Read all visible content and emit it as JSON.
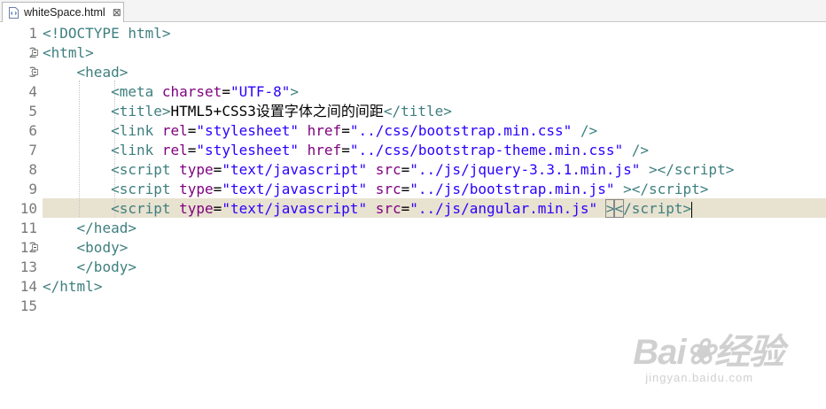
{
  "tab": {
    "filename": "whiteSpace.html",
    "close_symbol": "⊠"
  },
  "lines": [
    {
      "num": "1"
    },
    {
      "num": "2"
    },
    {
      "num": "3"
    },
    {
      "num": "4"
    },
    {
      "num": "5"
    },
    {
      "num": "6"
    },
    {
      "num": "7"
    },
    {
      "num": "8"
    },
    {
      "num": "9"
    },
    {
      "num": "10"
    },
    {
      "num": "11"
    },
    {
      "num": "12"
    },
    {
      "num": "13"
    },
    {
      "num": "14"
    },
    {
      "num": "15"
    }
  ],
  "code": {
    "doctype": "<!DOCTYPE html>",
    "html_open": "html",
    "head_open": "head",
    "meta": {
      "tag": "meta",
      "attr": "charset",
      "value": "\"UTF-8\""
    },
    "title": {
      "tag": "title",
      "text": "HTML5+CSS3设置字体之间的间距",
      "close": "/title"
    },
    "link1": {
      "tag": "link",
      "rel_attr": "rel",
      "rel": "\"stylesheet\"",
      "href_attr": "href",
      "href": "\"../css/bootstrap.min.css\""
    },
    "link2": {
      "tag": "link",
      "rel_attr": "rel",
      "rel": "\"stylesheet\"",
      "href_attr": "href",
      "href": "\"../css/bootstrap-theme.min.css\""
    },
    "script1": {
      "tag": "script",
      "type_attr": "type",
      "type": "\"text/javascript\"",
      "src_attr": "src",
      "src": "\"../js/jquery-3.3.1.min.js\"",
      "close": "/script"
    },
    "script2": {
      "tag": "script",
      "type_attr": "type",
      "type": "\"text/javascript\"",
      "src_attr": "src",
      "src": "\"../js/bootstrap.min.js\"",
      "close": "/script"
    },
    "script3": {
      "tag": "script",
      "type_attr": "type",
      "type": "\"text/javascript\"",
      "src_attr": "src",
      "src": "\"../js/angular.min.js\"",
      "close": "/script"
    },
    "head_close": "/head",
    "body_open": "body",
    "body_close": "/body",
    "html_close": "/html"
  },
  "watermark": {
    "brand": "Bai❀经验",
    "url": "jingyan.baidu.com"
  },
  "colors": {
    "tag": "#3f7f7f",
    "attr": "#7f007f",
    "value": "#2a00ff",
    "current_line": "#e8e2d0"
  }
}
